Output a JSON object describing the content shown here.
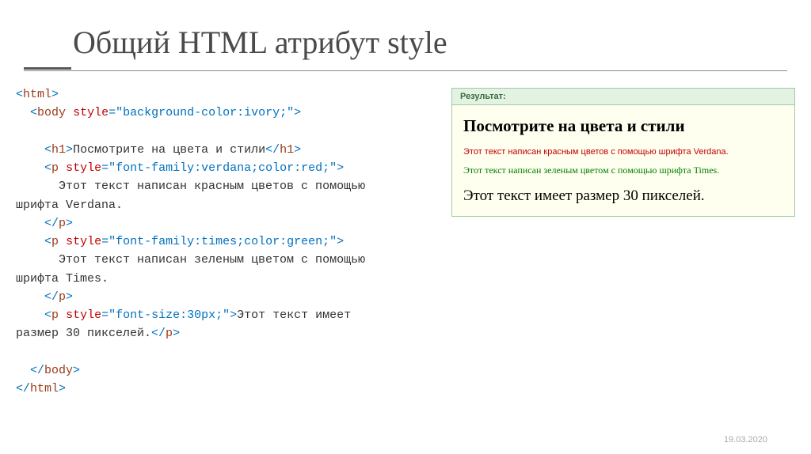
{
  "slide": {
    "title": "Общий HTML атрибут style",
    "date": "19.03.2020"
  },
  "code": {
    "lines": [
      {
        "parts": [
          {
            "t": "br",
            "v": "<"
          },
          {
            "t": "tn",
            "v": "html"
          },
          {
            "t": "br",
            "v": ">"
          }
        ]
      },
      {
        "parts": [
          {
            "t": "tx",
            "v": "  "
          },
          {
            "t": "br",
            "v": "<"
          },
          {
            "t": "tn",
            "v": "body"
          },
          {
            "t": "tx",
            "v": " "
          },
          {
            "t": "an",
            "v": "style"
          },
          {
            "t": "br",
            "v": "="
          },
          {
            "t": "av",
            "v": "\"background-color:ivory;\""
          },
          {
            "t": "br",
            "v": ">"
          }
        ]
      },
      {
        "parts": [
          {
            "t": "tx",
            "v": " "
          }
        ]
      },
      {
        "parts": [
          {
            "t": "tx",
            "v": "    "
          },
          {
            "t": "br",
            "v": "<"
          },
          {
            "t": "tn",
            "v": "h1"
          },
          {
            "t": "br",
            "v": ">"
          },
          {
            "t": "tx",
            "v": "Посмотрите на цвета и стили"
          },
          {
            "t": "br",
            "v": "</"
          },
          {
            "t": "tn",
            "v": "h1"
          },
          {
            "t": "br",
            "v": ">"
          }
        ]
      },
      {
        "parts": [
          {
            "t": "tx",
            "v": "    "
          },
          {
            "t": "br",
            "v": "<"
          },
          {
            "t": "tn",
            "v": "p"
          },
          {
            "t": "tx",
            "v": " "
          },
          {
            "t": "an",
            "v": "style"
          },
          {
            "t": "br",
            "v": "="
          },
          {
            "t": "av",
            "v": "\"font-family:verdana;color:red;\""
          },
          {
            "t": "br",
            "v": ">"
          }
        ]
      },
      {
        "parts": [
          {
            "t": "tx",
            "v": "      Этот текст написан красным цветов с помощью"
          }
        ]
      },
      {
        "parts": [
          {
            "t": "tx",
            "v": "шрифта Verdana."
          }
        ]
      },
      {
        "parts": [
          {
            "t": "tx",
            "v": "    "
          },
          {
            "t": "br",
            "v": "</"
          },
          {
            "t": "tn",
            "v": "p"
          },
          {
            "t": "br",
            "v": ">"
          }
        ]
      },
      {
        "parts": [
          {
            "t": "tx",
            "v": "    "
          },
          {
            "t": "br",
            "v": "<"
          },
          {
            "t": "tn",
            "v": "p"
          },
          {
            "t": "tx",
            "v": " "
          },
          {
            "t": "an",
            "v": "style"
          },
          {
            "t": "br",
            "v": "="
          },
          {
            "t": "av",
            "v": "\"font-family:times;color:green;\""
          },
          {
            "t": "br",
            "v": ">"
          }
        ]
      },
      {
        "parts": [
          {
            "t": "tx",
            "v": "      Этот текст написан зеленым цветом с помощью"
          }
        ]
      },
      {
        "parts": [
          {
            "t": "tx",
            "v": "шрифта Times."
          }
        ]
      },
      {
        "parts": [
          {
            "t": "tx",
            "v": "    "
          },
          {
            "t": "br",
            "v": "</"
          },
          {
            "t": "tn",
            "v": "p"
          },
          {
            "t": "br",
            "v": ">"
          }
        ]
      },
      {
        "parts": [
          {
            "t": "tx",
            "v": "    "
          },
          {
            "t": "br",
            "v": "<"
          },
          {
            "t": "tn",
            "v": "p"
          },
          {
            "t": "tx",
            "v": " "
          },
          {
            "t": "an",
            "v": "style"
          },
          {
            "t": "br",
            "v": "="
          },
          {
            "t": "av",
            "v": "\"font-size:30px;\""
          },
          {
            "t": "br",
            "v": ">"
          },
          {
            "t": "tx",
            "v": "Этот текст имеет"
          }
        ]
      },
      {
        "parts": [
          {
            "t": "tx",
            "v": "размер 30 пикселей."
          },
          {
            "t": "br",
            "v": "</"
          },
          {
            "t": "tn",
            "v": "p"
          },
          {
            "t": "br",
            "v": ">"
          }
        ]
      },
      {
        "parts": [
          {
            "t": "tx",
            "v": " "
          }
        ]
      },
      {
        "parts": [
          {
            "t": "tx",
            "v": "  "
          },
          {
            "t": "br",
            "v": "</"
          },
          {
            "t": "tn",
            "v": "body"
          },
          {
            "t": "br",
            "v": ">"
          }
        ]
      },
      {
        "parts": [
          {
            "t": "br",
            "v": "</"
          },
          {
            "t": "tn",
            "v": "html"
          },
          {
            "t": "br",
            "v": ">"
          }
        ]
      }
    ]
  },
  "result": {
    "header": "Результат:",
    "h1": "Посмотрите на цвета и стили",
    "p1": "Этот текст написан красным цветов с помощью шрифта Verdana.",
    "p2": "Этот текст написан зеленым цветом с помощью шрифта Times.",
    "p3": "Этот текст имеет размер 30 пикселей."
  }
}
